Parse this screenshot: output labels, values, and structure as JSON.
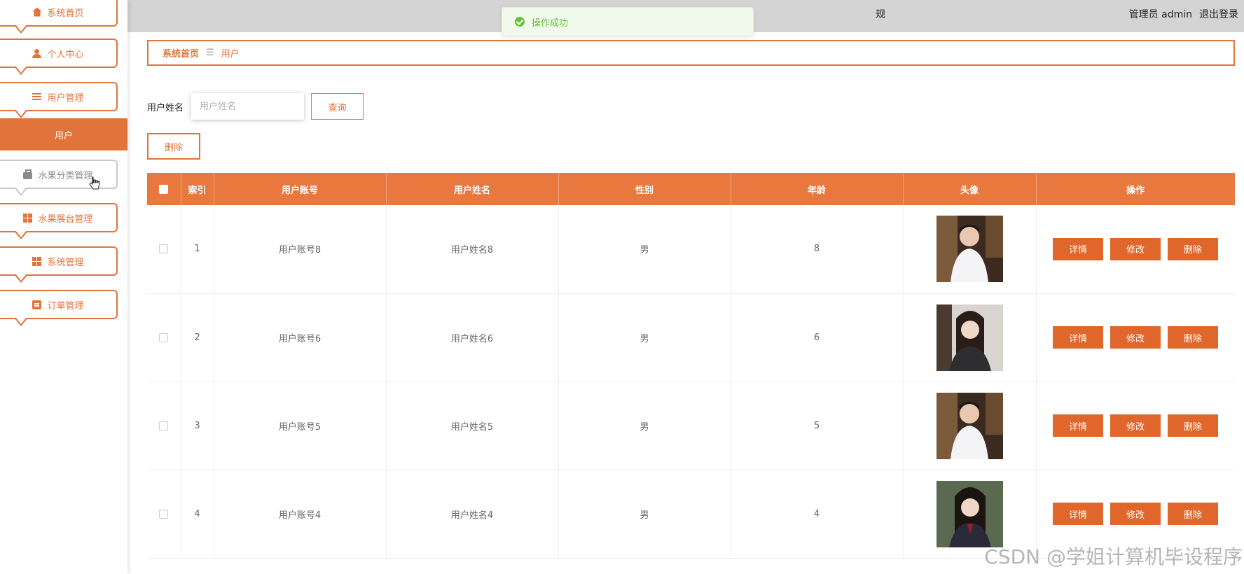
{
  "sidebar": {
    "items": [
      {
        "label": "系统首页",
        "icon": "home-icon"
      },
      {
        "label": "个人中心",
        "icon": "user-icon"
      },
      {
        "label": "用户管理",
        "icon": "list-icon"
      },
      {
        "label": "水果分类管理",
        "icon": "briefcase-icon"
      },
      {
        "label": "水果展台管理",
        "icon": "grid-icon"
      },
      {
        "label": "系统管理",
        "icon": "grid-icon"
      },
      {
        "label": "订单管理",
        "icon": "clipboard-icon"
      }
    ],
    "active_sub": "用户"
  },
  "header": {
    "partial_title": "规",
    "role": "管理员",
    "username": "admin",
    "logout": "退出登录"
  },
  "toast": {
    "message": "操作成功",
    "type": "success"
  },
  "breadcrumb": {
    "home": "系统首页",
    "separator": "☰",
    "current": "用户"
  },
  "search": {
    "label": "用户姓名",
    "placeholder": "用户姓名",
    "button": "查询"
  },
  "toolbar": {
    "delete_label": "删除"
  },
  "table": {
    "headers": {
      "index": "索引",
      "account": "用户账号",
      "name": "用户姓名",
      "gender": "性别",
      "age": "年龄",
      "avatar": "头像",
      "ops": "操作"
    },
    "rows": [
      {
        "index": "1",
        "account": "用户账号8",
        "name": "用户姓名8",
        "gender": "男",
        "age": "8"
      },
      {
        "index": "2",
        "account": "用户账号6",
        "name": "用户姓名6",
        "gender": "男",
        "age": "6"
      },
      {
        "index": "3",
        "account": "用户账号5",
        "name": "用户姓名5",
        "gender": "男",
        "age": "5"
      },
      {
        "index": "4",
        "account": "用户账号4",
        "name": "用户姓名4",
        "gender": "男",
        "age": "4"
      }
    ],
    "ops": {
      "detail": "详情",
      "edit": "修改",
      "delete": "删除"
    }
  },
  "watermark": "CSDN @学姐计算机毕设程序",
  "colors": {
    "accent": "#e2733a",
    "header": "#e8783e",
    "button": "#e0662b",
    "success": "#67c23a"
  }
}
